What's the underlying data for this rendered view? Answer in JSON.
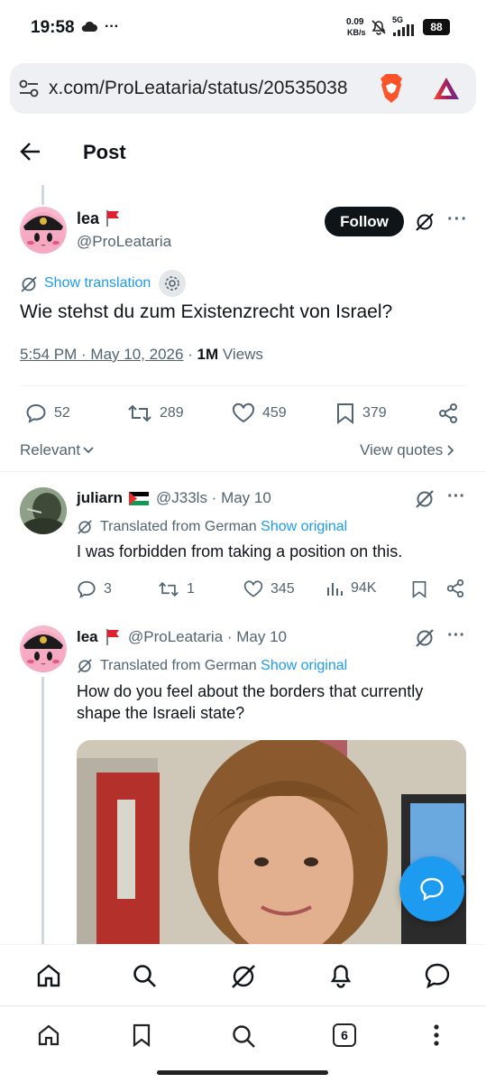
{
  "status_bar": {
    "time": "19:58",
    "net_speed_value": "0.09",
    "net_speed_unit": "KB/s",
    "network": "5G",
    "battery": "88"
  },
  "browser": {
    "url": "x.com/ProLeataria/status/20535038",
    "tab_count": "6"
  },
  "header": {
    "title": "Post"
  },
  "main_post": {
    "name": "lea",
    "handle": "@ProLeataria",
    "follow_label": "Follow",
    "show_translation": "Show translation",
    "text": "Wie stehst du zum Existenzrecht von Israel?",
    "timestamp": "5:54 PM · May 10, 2026",
    "separator": " · ",
    "views_count": "1M",
    "views_label": " Views",
    "replies": "52",
    "reposts": "289",
    "likes": "459",
    "bookmarks": "379",
    "sort_label": "Relevant",
    "view_quotes": "View quotes"
  },
  "replies": [
    {
      "name": "juliarn",
      "handle": "@J33ls",
      "date": "May 10",
      "translated_label": "Translated from German",
      "show_original": "Show original",
      "text": "I was forbidden from taking a position on this.",
      "replies": "3",
      "reposts": "1",
      "likes": "345",
      "views": "94K"
    },
    {
      "name": "lea",
      "handle": "@ProLeataria",
      "date": "May 10",
      "translated_label": "Translated from German",
      "show_original": "Show original",
      "text_line1": "How do you feel about the borders that currently",
      "text_line2": "shape the Israeli state?"
    }
  ],
  "colors": {
    "accent": "#1d9bf0",
    "text": "#0f1419",
    "secondary": "#536471",
    "follow_bg": "#0f1419"
  }
}
